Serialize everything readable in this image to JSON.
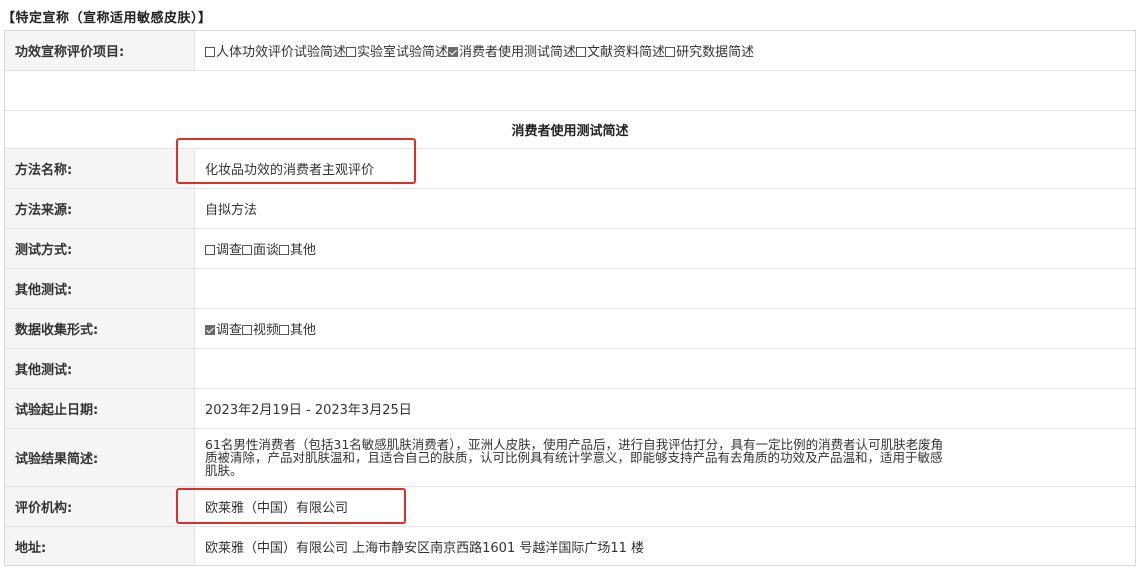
{
  "section_title": "【特定宣称（宣称适用敏感皮肤）】",
  "efficacy_row": {
    "label": "功效宣称评价项目:",
    "options": [
      {
        "label": "人体功效评价试验简述",
        "checked": false
      },
      {
        "label": "实验室试验简述",
        "checked": false
      },
      {
        "label": "消费者使用测试简述",
        "checked": true
      },
      {
        "label": "文献资料简述",
        "checked": false
      },
      {
        "label": "研究数据简述",
        "checked": false
      }
    ]
  },
  "section_header": "消费者使用测试简述",
  "method_name": {
    "label": "方法名称:",
    "value": "化妆品功效的消费者主观评价"
  },
  "method_source": {
    "label": "方法来源:",
    "value": "自拟方法"
  },
  "test_mode": {
    "label": "测试方式:",
    "options": [
      {
        "label": "调查",
        "checked": false
      },
      {
        "label": "面谈",
        "checked": false
      },
      {
        "label": "其他",
        "checked": false
      }
    ]
  },
  "other_test_1": {
    "label": "其他测试:",
    "value": ""
  },
  "data_collection": {
    "label": "数据收集形式:",
    "options": [
      {
        "label": "调查",
        "checked": true
      },
      {
        "label": "视频",
        "checked": false
      },
      {
        "label": "其他",
        "checked": false
      }
    ]
  },
  "other_test_2": {
    "label": "其他测试:",
    "value": ""
  },
  "test_dates": {
    "label": "试验起止日期:",
    "value": "2023年2月19日 - 2023年3月25日"
  },
  "result_summary": {
    "label": "试验结果简述:",
    "value": "61名男性消费者（包括31名敏感肌肤消费者），亚洲人皮肤，使用产品后，进行自我评估打分，具有一定比例的消费者认可肌肤老废角质被清除，产品对肌肤温和，且适合自己的肤质，认可比例具有统计学意义，即能够支持产品有去角质的功效及产品温和，适用于敏感肌肤。"
  },
  "institution": {
    "label": "评价机构:",
    "value": "欧莱雅（中国）有限公司"
  },
  "address": {
    "label": "地址:",
    "value": "欧莱雅（中国）有限公司 上海市静安区南京西路1601 号越洋国际广场11 楼"
  },
  "colors": {
    "highlight": "#d9302c",
    "label_bg": "#f5f5f5",
    "border": "#e3e3e3"
  }
}
